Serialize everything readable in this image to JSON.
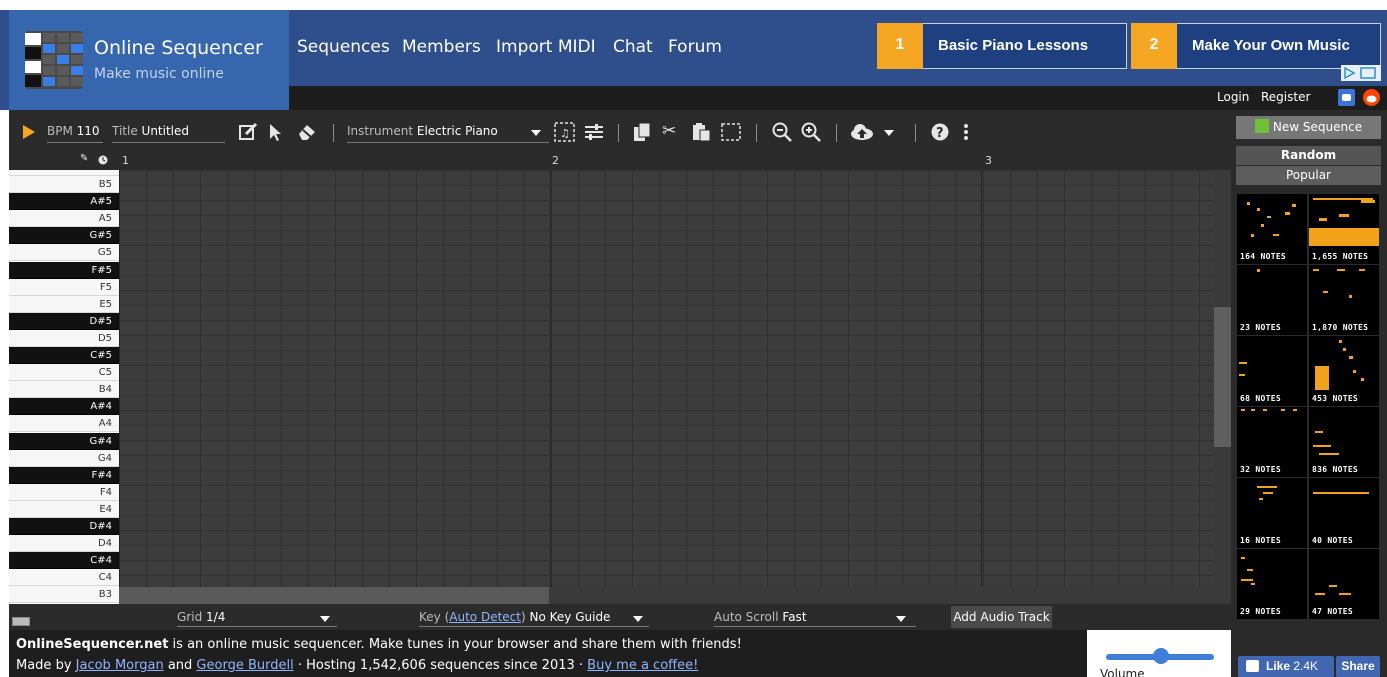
{
  "header": {
    "title": "Online Sequencer",
    "subtitle": "Make music online",
    "nav": [
      "Sequences",
      "Members",
      "Import MIDI",
      "Chat",
      "Forum"
    ],
    "ads": [
      {
        "number": "1",
        "label": "Basic Piano Lessons"
      },
      {
        "number": "2",
        "label": "Make Your Own Music"
      }
    ],
    "auth": {
      "login": "Login",
      "register": "Register"
    }
  },
  "toolbar": {
    "bpm_label": "BPM",
    "bpm_value": "110",
    "title_label": "Title",
    "title_value": "Untitled",
    "instrument_label": "Instrument",
    "instrument_value": "Electric Piano",
    "icons": [
      "play-icon",
      "pencil-icon",
      "pointer-icon",
      "eraser-icon",
      "instrument-dropdown-icon",
      "instrument-select-icon",
      "instrument-settings-icon",
      "copy-icon",
      "cut-icon",
      "paste-icon",
      "select-all-icon",
      "zoom-out-icon",
      "zoom-in-icon",
      "cloud-upload-icon",
      "upload-dropdown-icon",
      "help-icon",
      "more-icon"
    ]
  },
  "ruler": {
    "markers": [
      "1",
      "2",
      "3"
    ]
  },
  "piano_keys": [
    {
      "label": "B5",
      "black": false
    },
    {
      "label": "A#5",
      "black": true
    },
    {
      "label": "A5",
      "black": false
    },
    {
      "label": "G#5",
      "black": true
    },
    {
      "label": "G5",
      "black": false
    },
    {
      "label": "F#5",
      "black": true
    },
    {
      "label": "F5",
      "black": false
    },
    {
      "label": "E5",
      "black": false
    },
    {
      "label": "D#5",
      "black": true
    },
    {
      "label": "D5",
      "black": false
    },
    {
      "label": "C#5",
      "black": true
    },
    {
      "label": "C5",
      "black": false
    },
    {
      "label": "B4",
      "black": false
    },
    {
      "label": "A#4",
      "black": true
    },
    {
      "label": "A4",
      "black": false
    },
    {
      "label": "G#4",
      "black": true
    },
    {
      "label": "G4",
      "black": false
    },
    {
      "label": "F#4",
      "black": true
    },
    {
      "label": "F4",
      "black": false
    },
    {
      "label": "E4",
      "black": false
    },
    {
      "label": "D#4",
      "black": true
    },
    {
      "label": "D4",
      "black": false
    },
    {
      "label": "C#4",
      "black": true
    },
    {
      "label": "C4",
      "black": false
    },
    {
      "label": "B3",
      "black": false
    }
  ],
  "bottom_bar": {
    "grid_label": "Grid",
    "grid_value": "1/4",
    "key_label": "Key",
    "key_link": "Auto Detect",
    "key_value": "No Key Guide",
    "autoscroll_label": "Auto Scroll",
    "autoscroll_value": "Fast",
    "add_audio_track": "Add Audio Track"
  },
  "footer": {
    "site": "OnlineSequencer.net",
    "line1_rest": " is an online music sequencer. Make tunes in your browser and share them with friends!",
    "made_by": "Made by ",
    "author1": "Jacob Morgan",
    "and": " and ",
    "author2": "George Burdell",
    "hosting": " · Hosting 1,542,606 sequences since 2013 · ",
    "coffee": "Buy me a coffee!",
    "volume_label": "Volume",
    "volume_level": 0.5
  },
  "sidebar": {
    "new_sequence": "New Sequence",
    "random": "Random",
    "popular": "Popular",
    "thumbnails": [
      {
        "notes": "164 NOTES"
      },
      {
        "notes": "1,655 NOTES"
      },
      {
        "notes": "23 NOTES"
      },
      {
        "notes": "1,870 NOTES"
      },
      {
        "notes": "68 NOTES"
      },
      {
        "notes": "453 NOTES"
      },
      {
        "notes": "32 NOTES"
      },
      {
        "notes": "836 NOTES"
      },
      {
        "notes": "16 NOTES"
      },
      {
        "notes": "40 NOTES"
      },
      {
        "notes": "29 NOTES"
      },
      {
        "notes": "47 NOTES"
      }
    ],
    "fb_like": "Like",
    "fb_count": "2.4K",
    "fb_share": "Share"
  },
  "colors": {
    "header": "#2f4e8c",
    "logo_bg": "#3566ae",
    "accent_orange": "#f5a623",
    "note": "#f0a21a",
    "workspace": "#2b2b2b"
  }
}
